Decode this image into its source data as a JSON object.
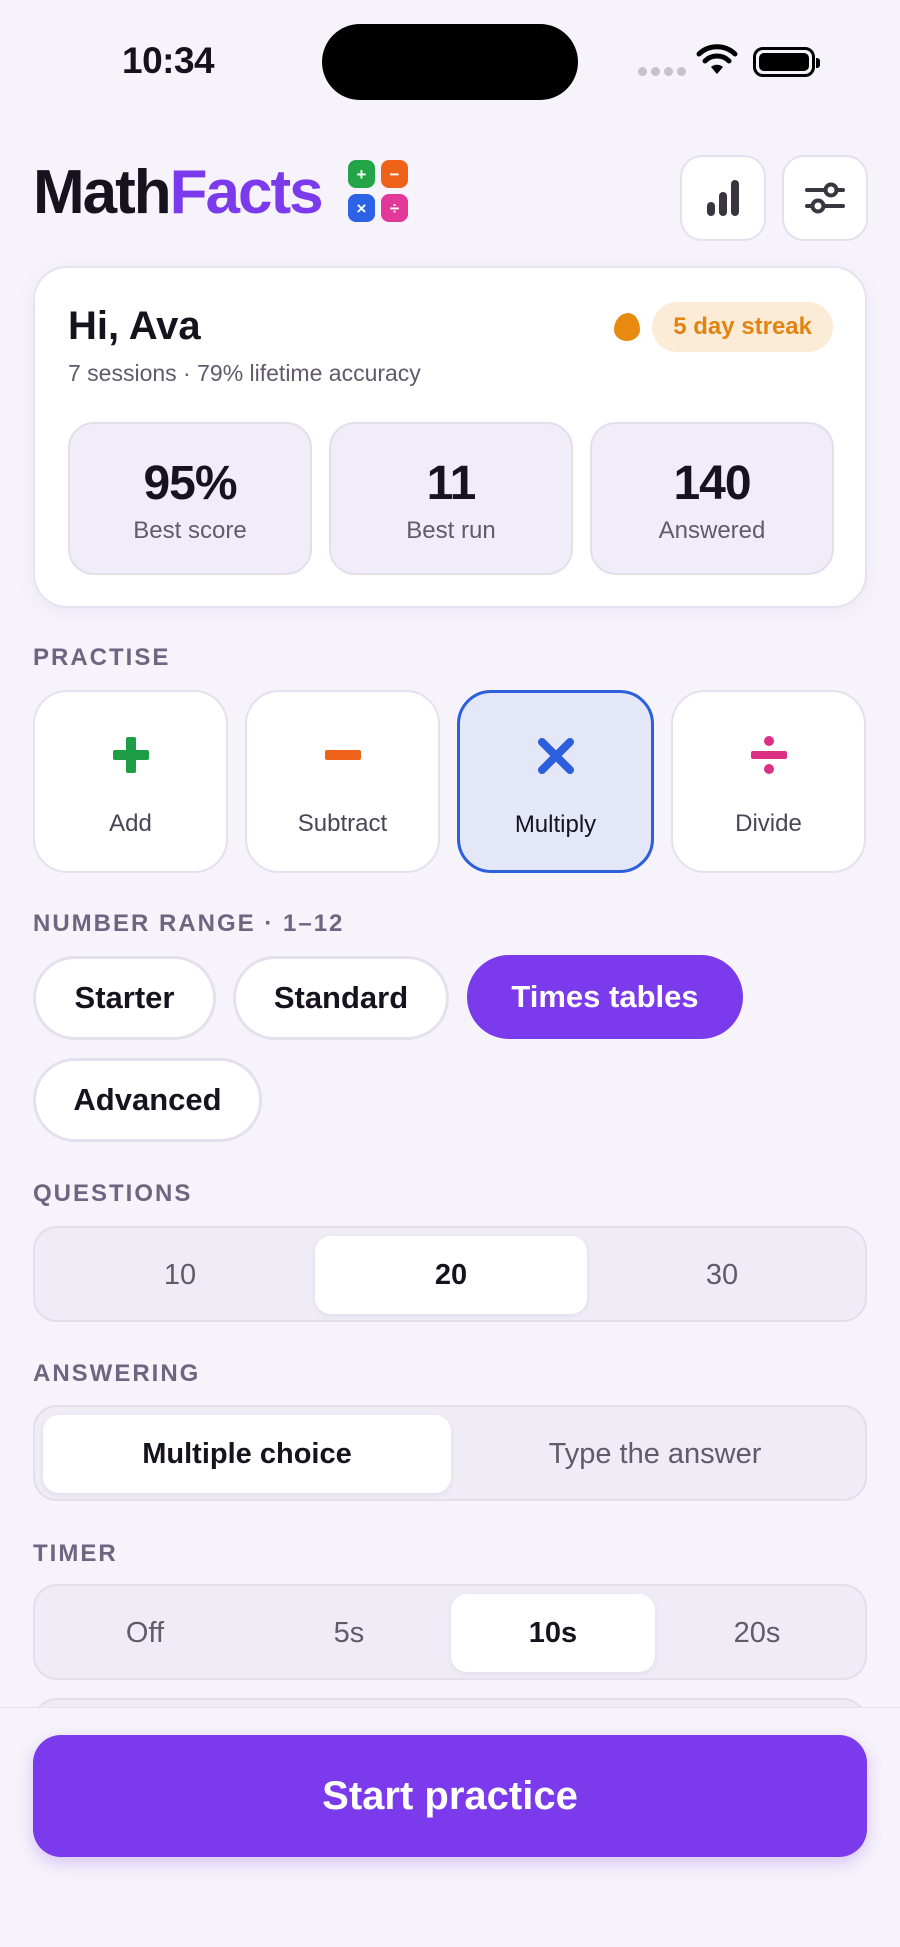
{
  "status_bar": {
    "time": "10:34"
  },
  "header": {
    "logo_part1": "Math",
    "logo_part2": "Facts",
    "logo_tiles": [
      {
        "symbol": "+",
        "color": "#22A447"
      },
      {
        "symbol": "−",
        "color": "#EE6319"
      },
      {
        "symbol": "×",
        "color": "#2C63E4"
      },
      {
        "symbol": "÷",
        "color": "#E2389A"
      }
    ],
    "stats_icon": "bar-chart-icon",
    "settings_icon": "sliders-icon"
  },
  "profile": {
    "greeting": "Hi, Ava",
    "subtitle": "7 sessions · 79% lifetime accuracy",
    "streak": "5 day streak",
    "stats": [
      {
        "value": "95%",
        "label": "Best score"
      },
      {
        "value": "11",
        "label": "Best run"
      },
      {
        "value": "140",
        "label": "Answered"
      }
    ]
  },
  "practise": {
    "label": "PRACTISE",
    "operations": [
      {
        "label": "Add",
        "symbol": "+",
        "color": "#1E9E44",
        "selected": false
      },
      {
        "label": "Subtract",
        "symbol": "−",
        "color": "#EE6319",
        "selected": false
      },
      {
        "label": "Multiply",
        "symbol": "×",
        "color": "#2C5FDC",
        "selected": true
      },
      {
        "label": "Divide",
        "symbol": "÷",
        "color": "#DC2F86",
        "selected": false
      }
    ]
  },
  "range": {
    "label": "NUMBER RANGE · 1–12",
    "options": [
      {
        "label": "Starter",
        "active": false
      },
      {
        "label": "Standard",
        "active": false
      },
      {
        "label": "Times tables",
        "active": true
      },
      {
        "label": "Advanced",
        "active": false
      }
    ]
  },
  "questions": {
    "label": "QUESTIONS",
    "options": [
      {
        "label": "10",
        "active": false
      },
      {
        "label": "20",
        "active": true
      },
      {
        "label": "30",
        "active": false
      }
    ]
  },
  "answering": {
    "label": "ANSWERING",
    "options": [
      {
        "label": "Multiple choice",
        "active": true
      },
      {
        "label": "Type the answer",
        "active": false
      }
    ]
  },
  "timer": {
    "label": "TIMER",
    "options": [
      {
        "label": "Off",
        "active": false
      },
      {
        "label": "5s",
        "active": false
      },
      {
        "label": "10s",
        "active": true
      },
      {
        "label": "20s",
        "active": false
      }
    ]
  },
  "start_button": "Start practice",
  "colors": {
    "accent": "#7B3AEC",
    "background": "#F6F3FB",
    "selected_blue": "#2C5FDC"
  }
}
